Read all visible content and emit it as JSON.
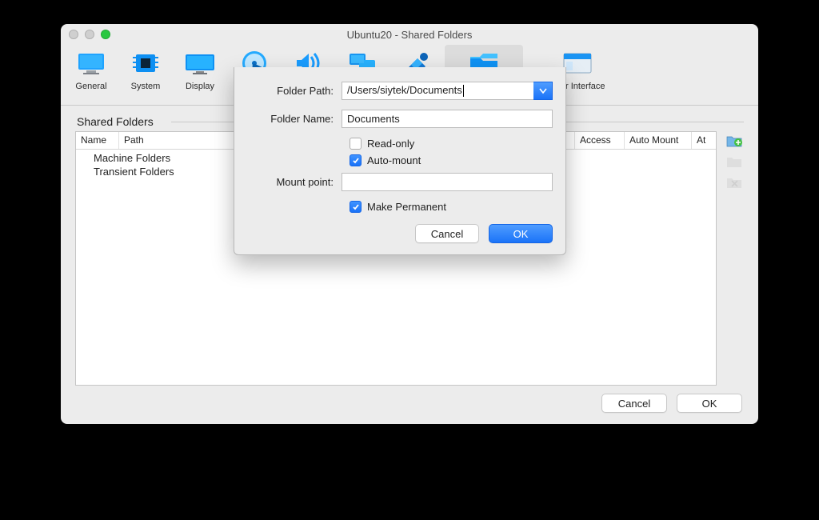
{
  "window": {
    "title": "Ubuntu20 - Shared Folders"
  },
  "toolbar": {
    "general": "General",
    "system": "System",
    "display": "Display",
    "storage": "Storage",
    "audio": "Audio",
    "network": "Network",
    "ports": "Ports",
    "shared_folders": "Shared Folders",
    "user_interface": "User Interface"
  },
  "shared": {
    "section": "Shared Folders",
    "headers": {
      "name": "Name",
      "path": "Path",
      "access": "Access",
      "auto_mount": "Auto Mount",
      "at": "At"
    },
    "rows": {
      "machine": "Machine Folders",
      "transient": "Transient Folders"
    }
  },
  "dialog": {
    "folder_path_label": "Folder Path:",
    "folder_path_value": "/Users/siytek/Documents",
    "folder_name_label": "Folder Name:",
    "folder_name_value": "Documents",
    "read_only": "Read-only",
    "auto_mount": "Auto-mount",
    "mount_point_label": "Mount point:",
    "mount_point_value": "",
    "make_permanent": "Make Permanent",
    "cancel": "Cancel",
    "ok": "OK"
  },
  "buttons": {
    "cancel": "Cancel",
    "ok": "OK"
  }
}
